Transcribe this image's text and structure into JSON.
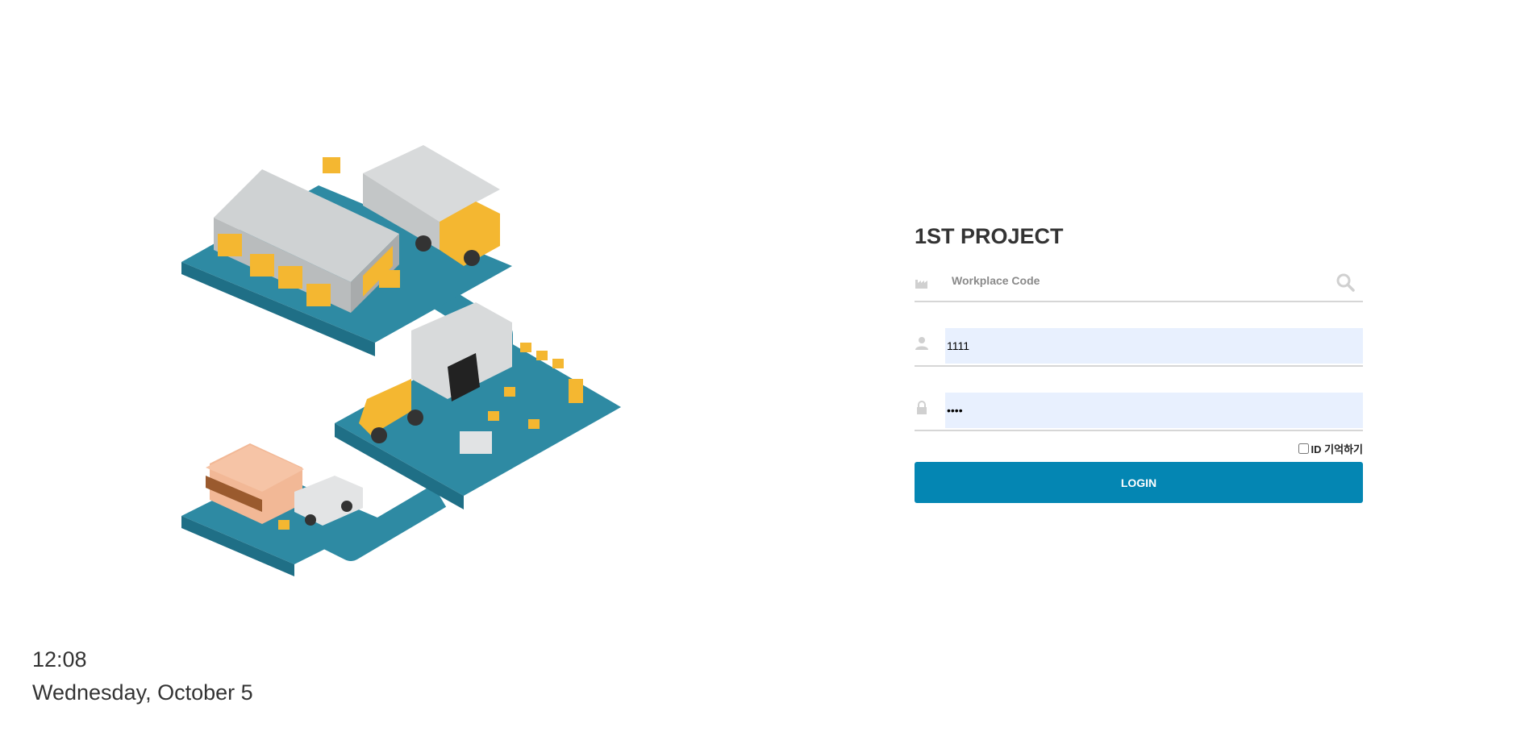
{
  "login": {
    "title": "1ST PROJECT",
    "workplace_placeholder": "Workplace Code",
    "workplace_value": "",
    "user_id_value": "1111",
    "password_value": "1111",
    "remember_label": "ID 기억하기",
    "login_label": "LOGIN"
  },
  "clock": {
    "time": "12:08",
    "date": "Wednesday, October 5"
  },
  "colors": {
    "button": "#0486b3",
    "autofill": "#e8f0fe",
    "road": "#2e8aa3",
    "accent": "#f4b731"
  },
  "icons": {
    "workplace": "factory-icon",
    "search": "search-icon",
    "user": "user-icon",
    "password": "lock-icon"
  }
}
